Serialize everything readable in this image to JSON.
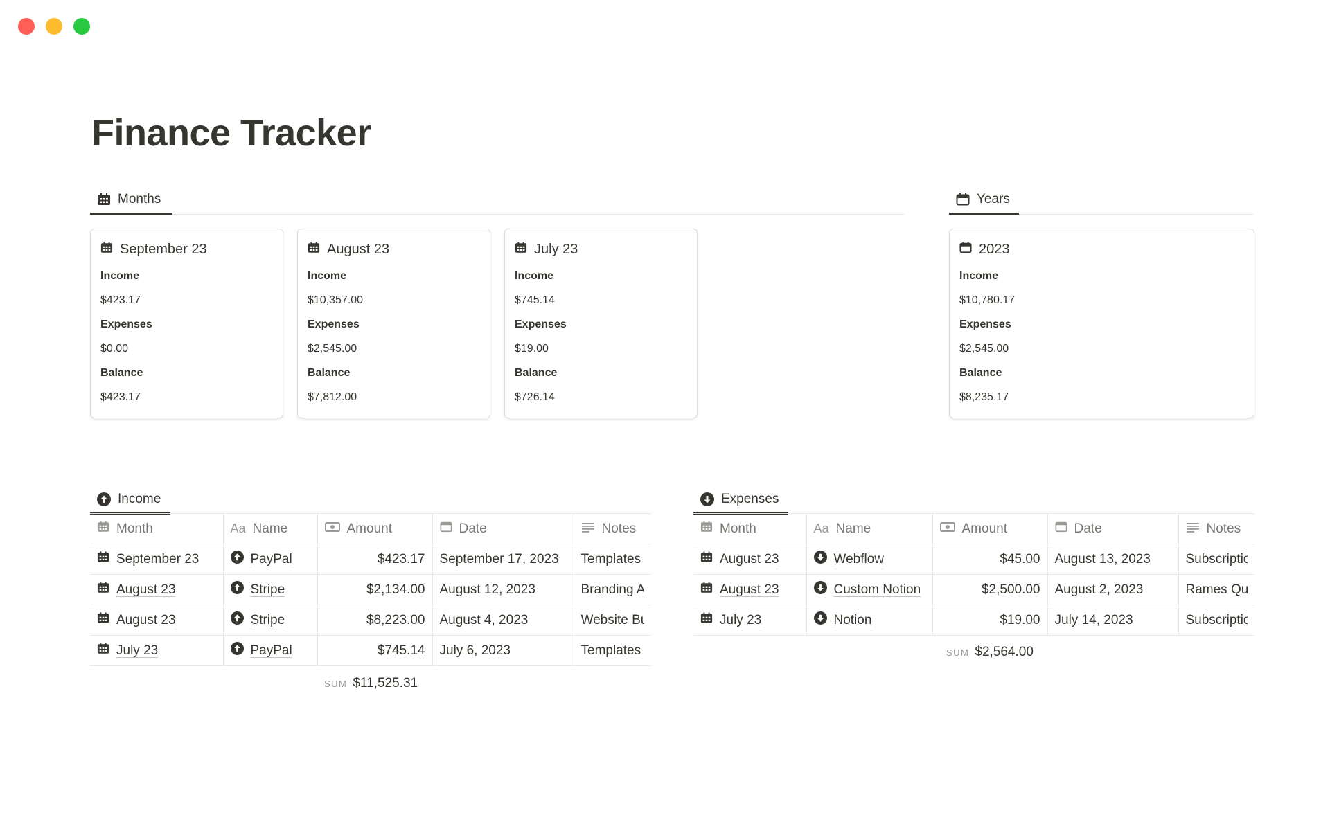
{
  "page": {
    "title": "Finance Tracker"
  },
  "window_controls": [
    "close",
    "minimize",
    "zoom"
  ],
  "months_view": {
    "tab_label": "Months",
    "cards": [
      {
        "title": "September 23",
        "income_label": "Income",
        "income": "$423.17",
        "expenses_label": "Expenses",
        "expenses": "$0.00",
        "balance_label": "Balance",
        "balance": "$423.17"
      },
      {
        "title": "August 23",
        "income_label": "Income",
        "income": "$10,357.00",
        "expenses_label": "Expenses",
        "expenses": "$2,545.00",
        "balance_label": "Balance",
        "balance": "$7,812.00"
      },
      {
        "title": "July 23",
        "income_label": "Income",
        "income": "$745.14",
        "expenses_label": "Expenses",
        "expenses": "$19.00",
        "balance_label": "Balance",
        "balance": "$726.14"
      }
    ]
  },
  "years_view": {
    "tab_label": "Years",
    "cards": [
      {
        "title": "2023",
        "income_label": "Income",
        "income": "$10,780.17",
        "expenses_label": "Expenses",
        "expenses": "$2,545.00",
        "balance_label": "Balance",
        "balance": "$8,235.17"
      }
    ]
  },
  "income": {
    "tab_label": "Income",
    "columns": {
      "month": "Month",
      "name_icon": "Aa",
      "name": "Name",
      "amount": "Amount",
      "date": "Date",
      "notes": "Notes"
    },
    "rows": [
      {
        "month": "September 23",
        "name": "PayPal",
        "amount": "$423.17",
        "date": "September 17, 2023",
        "notes": "Templates"
      },
      {
        "month": "August 23",
        "name": "Stripe",
        "amount": "$2,134.00",
        "date": "August 12, 2023",
        "notes": "Branding Ar"
      },
      {
        "month": "August 23",
        "name": "Stripe",
        "amount": "$8,223.00",
        "date": "August 4, 2023",
        "notes": "Website Bu"
      },
      {
        "month": "July 23",
        "name": "PayPal",
        "amount": "$745.14",
        "date": "July 6, 2023",
        "notes": "Templates"
      }
    ],
    "sum_label": "SUM",
    "sum_value": "$11,525.31"
  },
  "expenses": {
    "tab_label": "Expenses",
    "columns": {
      "month": "Month",
      "name_icon": "Aa",
      "name": "Name",
      "amount": "Amount",
      "date": "Date",
      "notes": "Notes"
    },
    "rows": [
      {
        "month": "August 23",
        "name": "Webflow",
        "amount": "$45.00",
        "date": "August 13, 2023",
        "notes": "Subscriptio"
      },
      {
        "month": "August 23",
        "name": "Custom Notion",
        "amount": "$2,500.00",
        "date": "August 2, 2023",
        "notes": "Rames Quir"
      },
      {
        "month": "July 23",
        "name": "Notion",
        "amount": "$19.00",
        "date": "July 14, 2023",
        "notes": "Subscriptio"
      }
    ],
    "sum_label": "SUM",
    "sum_value": "$2,564.00"
  },
  "colors": {
    "text": "#37352f",
    "muted": "#787774",
    "border": "#e9e9e7",
    "close": "#ff5f57",
    "minimize": "#febc2e",
    "zoom": "#28c840"
  }
}
